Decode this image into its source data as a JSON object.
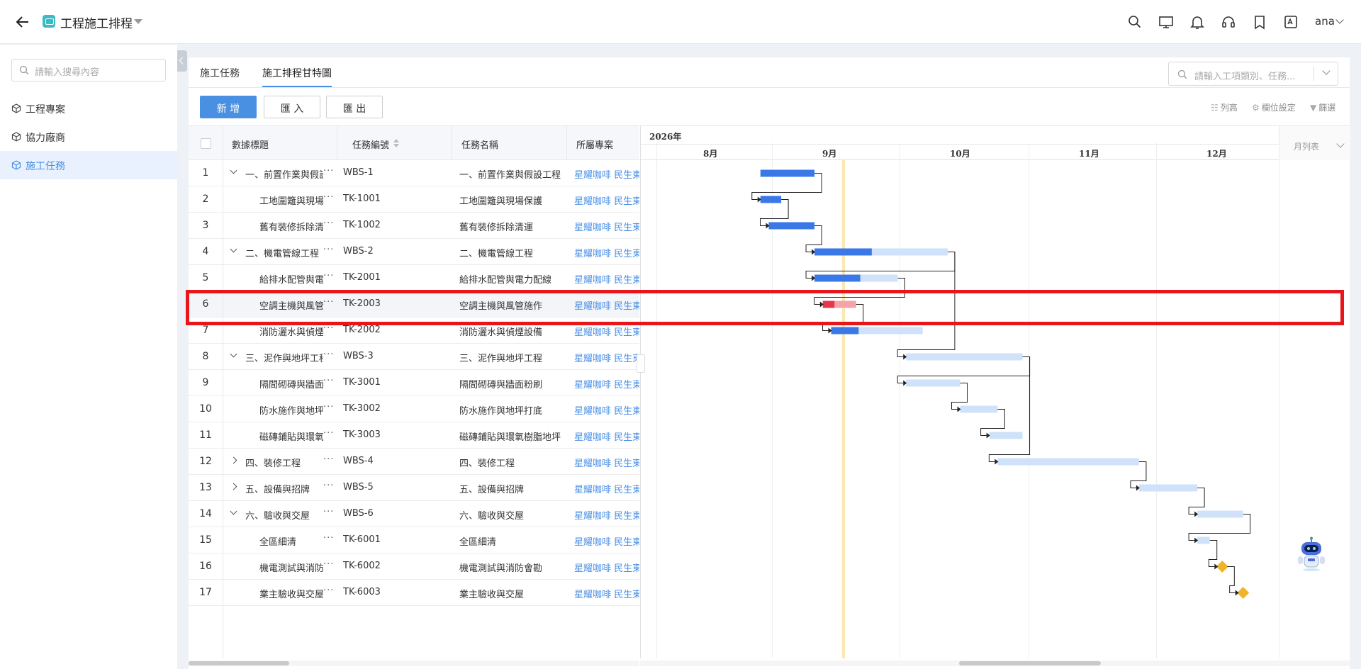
{
  "app": {
    "title": "工程施工排程",
    "user": "ana"
  },
  "sidebar": {
    "search_placeholder": "請輸入搜尋內容",
    "items": [
      {
        "label": "工程專案"
      },
      {
        "label": "協力廠商"
      },
      {
        "label": "施工任務"
      }
    ]
  },
  "tabs": [
    {
      "label": "施工任務"
    },
    {
      "label": "施工排程甘特圖"
    }
  ],
  "top_search_placeholder": "請輸入工項類別、任務...",
  "buttons": {
    "add": "新 增",
    "import": "匯 入",
    "export": "匯 出"
  },
  "tools": {
    "row_height": "列高",
    "column_settings": "欄位設定",
    "filter": "篩選"
  },
  "table": {
    "headers": {
      "title": "數據標題",
      "code": "任務編號",
      "name": "任務名稱",
      "project": "所屬專案"
    },
    "rows": [
      {
        "no": "1",
        "title": "一、前置作業與假設工程",
        "code": "WBS-1",
        "name": "一、前置作業與假設工程",
        "project": "星耀咖啡 民生東路店",
        "level": 0,
        "toggle": "down"
      },
      {
        "no": "2",
        "title": "工地圍籬與現場保護",
        "code": "TK-1001",
        "name": "工地圍籬與現場保護",
        "project": "星耀咖啡 民生東路店",
        "level": 1
      },
      {
        "no": "3",
        "title": "舊有裝修拆除清運",
        "code": "TK-1002",
        "name": "舊有裝修拆除清運",
        "project": "星耀咖啡 民生東路店",
        "level": 1
      },
      {
        "no": "4",
        "title": "二、機電管線工程",
        "code": "WBS-2",
        "name": "二、機電管線工程",
        "project": "星耀咖啡 民生東路店",
        "level": 0,
        "toggle": "down"
      },
      {
        "no": "5",
        "title": "給排水配管與電力配線",
        "code": "TK-2001",
        "name": "給排水配管與電力配線",
        "project": "星耀咖啡 民生東路店",
        "level": 1
      },
      {
        "no": "6",
        "title": "空調主機與風管施作",
        "code": "TK-2003",
        "name": "空調主機與風管施作",
        "project": "星耀咖啡 民生東路店",
        "level": 1
      },
      {
        "no": "7",
        "title": "消防灑水與偵煙設備",
        "code": "TK-2002",
        "name": "消防灑水與偵煙設備",
        "project": "星耀咖啡 民生東路店",
        "level": 1
      },
      {
        "no": "8",
        "title": "三、泥作與地坪工程",
        "code": "WBS-3",
        "name": "三、泥作與地坪工程",
        "project": "星耀咖啡 民生東路店",
        "level": 0,
        "toggle": "down"
      },
      {
        "no": "9",
        "title": "隔間砌磚與牆面粉刷",
        "code": "TK-3001",
        "name": "隔間砌磚與牆面粉刷",
        "project": "星耀咖啡 民生東路店",
        "level": 1
      },
      {
        "no": "10",
        "title": "防水施作與地坪打底",
        "code": "TK-3002",
        "name": "防水施作與地坪打底",
        "project": "星耀咖啡 民生東路店",
        "level": 1
      },
      {
        "no": "11",
        "title": "磁磚鋪貼與環氧樹脂地坪",
        "code": "TK-3003",
        "name": "磁磚鋪貼與環氧樹脂地坪",
        "project": "星耀咖啡 民生東路店",
        "level": 1
      },
      {
        "no": "12",
        "title": "四、裝修工程",
        "code": "WBS-4",
        "name": "四、裝修工程",
        "project": "星耀咖啡 民生東路店",
        "level": 0,
        "toggle": "right"
      },
      {
        "no": "13",
        "title": "五、設備與招牌",
        "code": "WBS-5",
        "name": "五、設備與招牌",
        "project": "星耀咖啡 民生東路店",
        "level": 0,
        "toggle": "right"
      },
      {
        "no": "14",
        "title": "六、驗收與交屋",
        "code": "WBS-6",
        "name": "六、驗收與交屋",
        "project": "星耀咖啡 民生東路店",
        "level": 0,
        "toggle": "down"
      },
      {
        "no": "15",
        "title": "全區細清",
        "code": "TK-6001",
        "name": "全區細清",
        "project": "星耀咖啡 民生東路店",
        "level": 1
      },
      {
        "no": "16",
        "title": "機電測試與消防會勘",
        "code": "TK-6002",
        "name": "機電測試與消防會勘",
        "project": "星耀咖啡 民生東路店",
        "level": 1
      },
      {
        "no": "17",
        "title": "業主驗收與交屋",
        "code": "TK-6003",
        "name": "業主驗收與交屋",
        "project": "星耀咖啡 民生東路店",
        "level": 1
      }
    ]
  },
  "gantt": {
    "year": "2026年",
    "months": [
      "8月",
      "9月",
      "10月",
      "11月",
      "12月"
    ],
    "view_mode": "月列表",
    "bars": [
      {
        "row": 1,
        "start": "2026-08-26",
        "end": "2026-09-08",
        "progress": 1.0,
        "kind": "summary"
      },
      {
        "row": 2,
        "start": "2026-08-26",
        "end": "2026-08-31",
        "progress": 1.0,
        "kind": "task"
      },
      {
        "row": 3,
        "start": "2026-08-28",
        "end": "2026-09-08",
        "progress": 1.0,
        "kind": "task"
      },
      {
        "row": 4,
        "start": "2026-09-08",
        "end": "2026-10-10",
        "progress": 0.43,
        "kind": "summary"
      },
      {
        "row": 5,
        "start": "2026-09-08",
        "end": "2026-09-28",
        "progress": 0.55,
        "kind": "task"
      },
      {
        "row": 6,
        "start": "2026-09-10",
        "end": "2026-09-18",
        "progress": 0.35,
        "kind": "critical"
      },
      {
        "row": 7,
        "start": "2026-09-12",
        "end": "2026-10-04",
        "progress": 0.3,
        "kind": "task"
      },
      {
        "row": 8,
        "start": "2026-09-30",
        "end": "2026-10-28",
        "progress": 0.0,
        "kind": "summary"
      },
      {
        "row": 9,
        "start": "2026-09-30",
        "end": "2026-10-13",
        "progress": 0.0,
        "kind": "task"
      },
      {
        "row": 10,
        "start": "2026-10-13",
        "end": "2026-10-22",
        "progress": 0.0,
        "kind": "task"
      },
      {
        "row": 11,
        "start": "2026-10-20",
        "end": "2026-10-28",
        "progress": 0.0,
        "kind": "task"
      },
      {
        "row": 12,
        "start": "2026-10-22",
        "end": "2026-11-25",
        "progress": 0.0,
        "kind": "summary"
      },
      {
        "row": 13,
        "start": "2026-11-25",
        "end": "2026-12-09",
        "progress": 0.0,
        "kind": "summary"
      },
      {
        "row": 14,
        "start": "2026-12-09",
        "end": "2026-12-20",
        "progress": 0.0,
        "kind": "summary"
      },
      {
        "row": 15,
        "start": "2026-12-09",
        "end": "2026-12-12",
        "progress": 0.0,
        "kind": "task"
      },
      {
        "row": 16,
        "date": "2026-12-15",
        "kind": "milestone"
      },
      {
        "row": 17,
        "date": "2026-12-20",
        "kind": "milestone"
      }
    ],
    "colors": {
      "done": "#3b78e7",
      "remaining": "#cfe2fa",
      "critical_done": "#e8364a",
      "critical_remaining": "#f5a3ab",
      "milestone": "#f0b429",
      "today": "#fbe8b2"
    }
  },
  "highlight_row": 6
}
